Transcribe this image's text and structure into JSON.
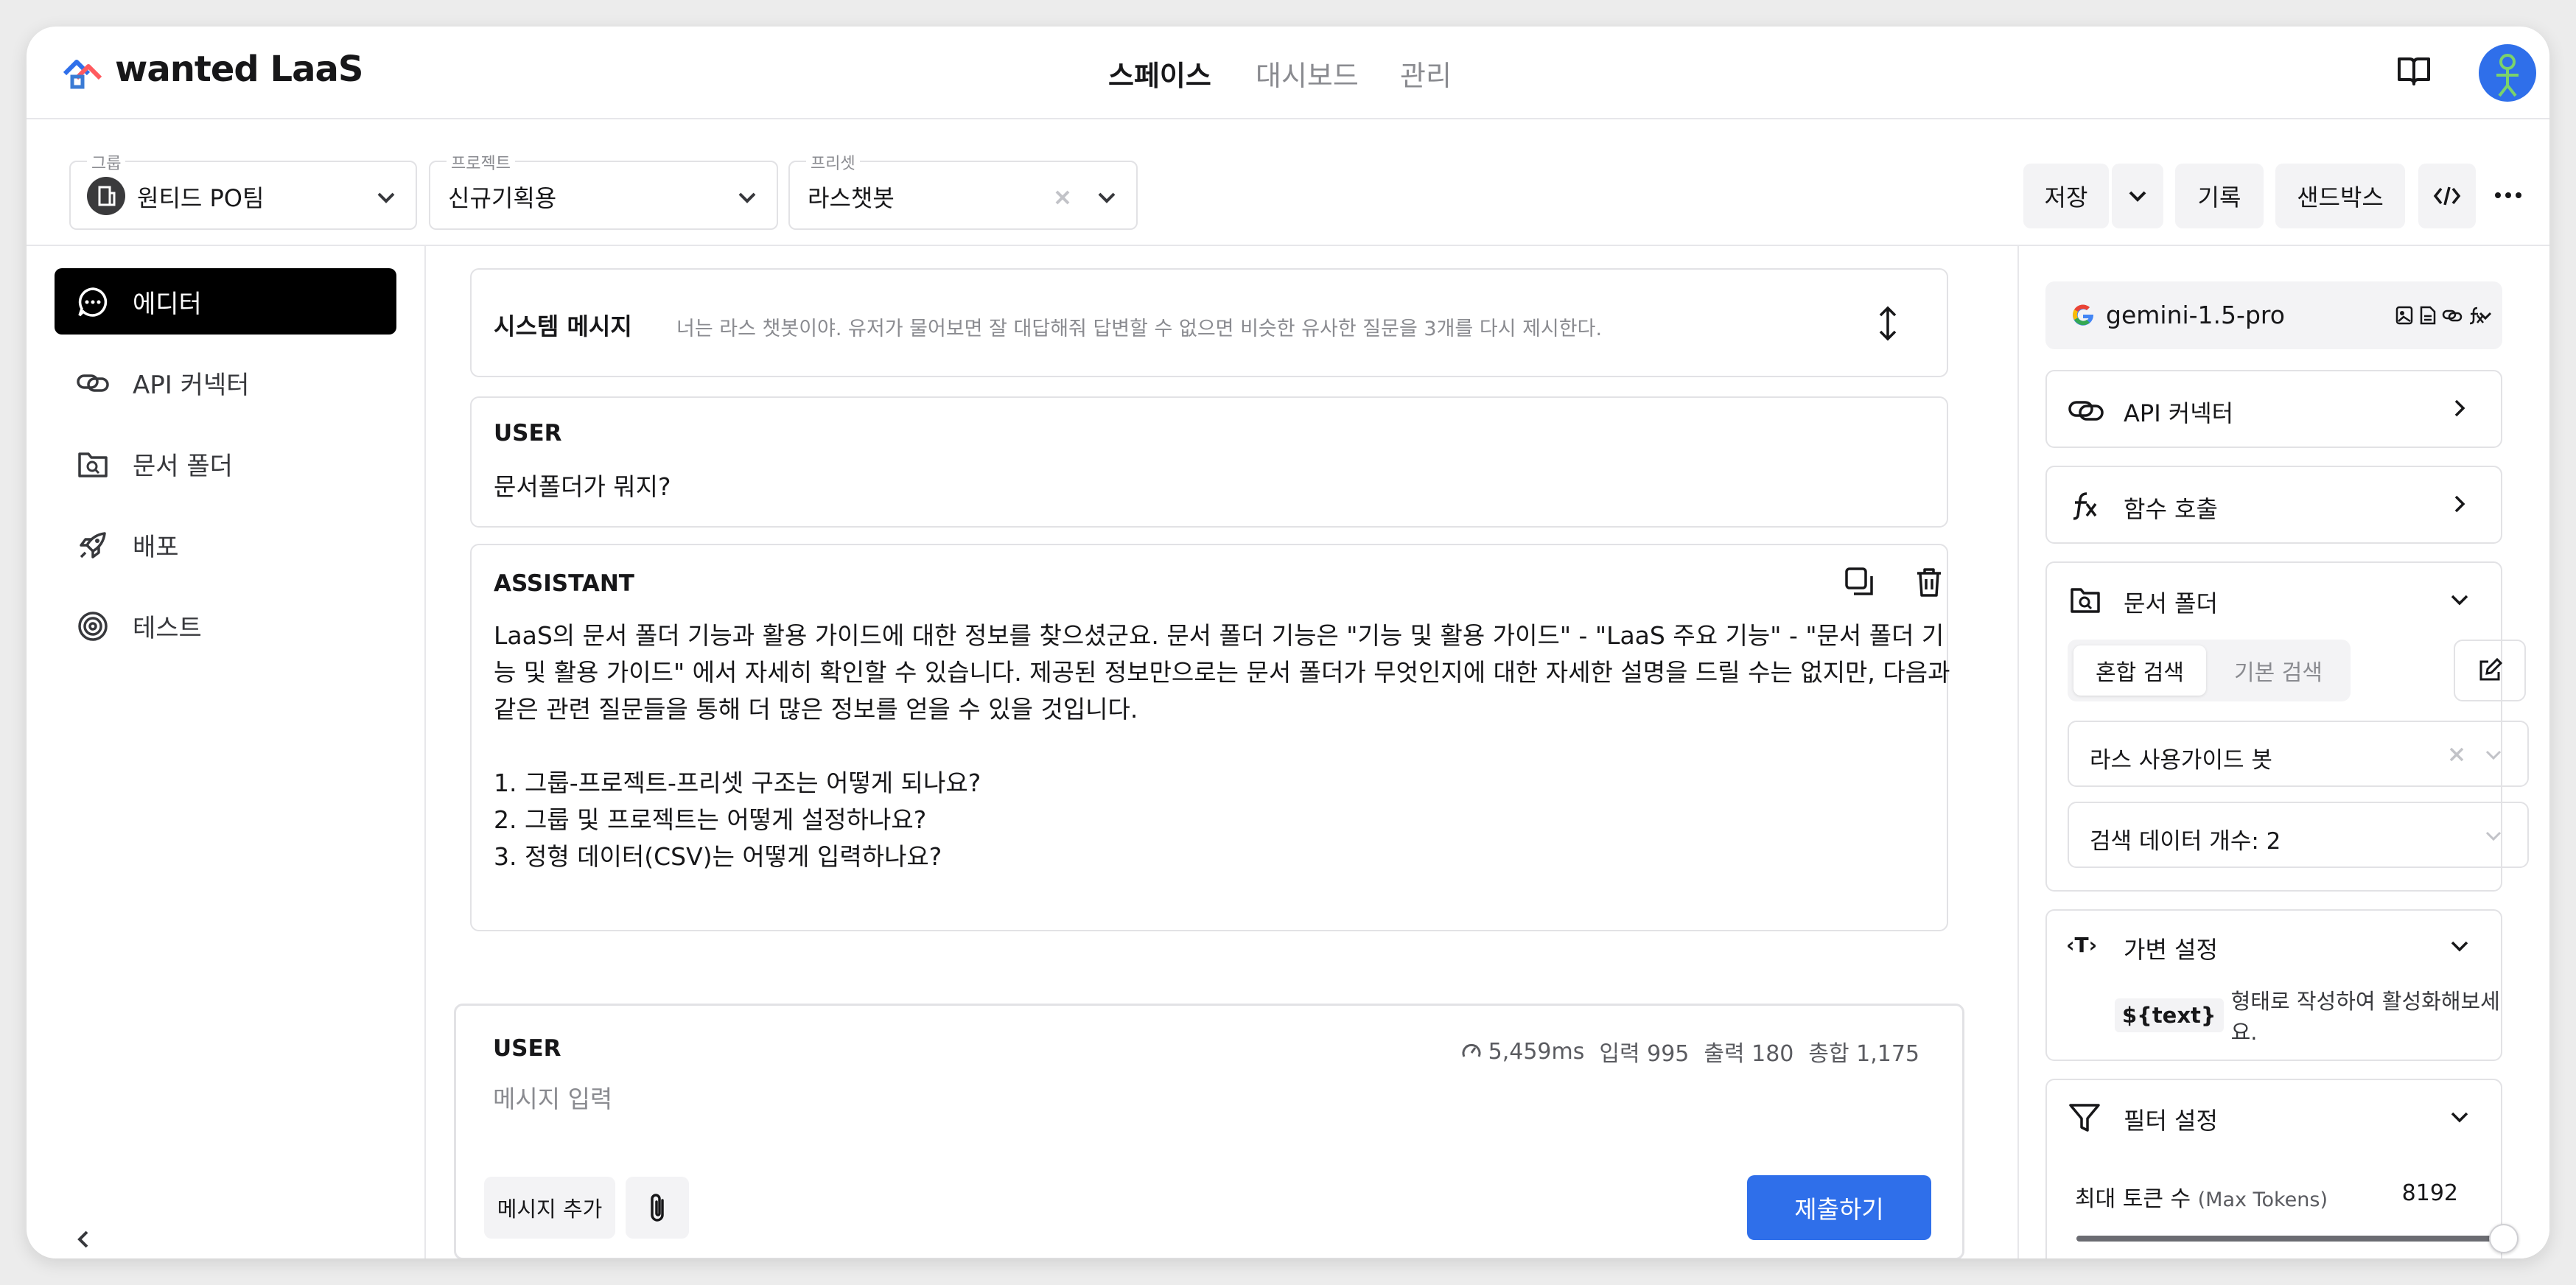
{
  "header": {
    "logo_text": "wanted LaaS",
    "nav": [
      {
        "label": "스페이스",
        "active": true
      },
      {
        "label": "대시보드",
        "active": false
      },
      {
        "label": "관리",
        "active": false
      }
    ]
  },
  "toolbar": {
    "group": {
      "label": "그룹",
      "value": "원티드 PO팀"
    },
    "project": {
      "label": "프로젝트",
      "value": "신규기획용"
    },
    "preset": {
      "label": "프리셋",
      "value": "라스챗봇"
    },
    "save_label": "저장",
    "history_label": "기록",
    "sandbox_label": "샌드박스"
  },
  "sidebar": {
    "items": [
      {
        "label": "에디터",
        "icon": "chat-bubble-icon",
        "active": true
      },
      {
        "label": "API 커넥터",
        "icon": "link-icon",
        "active": false
      },
      {
        "label": "문서 폴더",
        "icon": "folder-search-icon",
        "active": false
      },
      {
        "label": "배포",
        "icon": "rocket-icon",
        "active": false
      },
      {
        "label": "테스트",
        "icon": "target-icon",
        "active": false
      }
    ]
  },
  "editor": {
    "system_label": "시스템 메시지",
    "system_text": "너는 라스 챗봇이야. 유저가 물어보면 잘 대답해줘 답변할 수 없으면 비슷한 유사한 질문을 3개를 다시 제시한다.",
    "user_role": "USER",
    "user_text": "문서폴더가 뭐지?",
    "assistant_role": "ASSISTANT",
    "assistant_lines": [
      "LaaS의 문서 폴더 기능과 활용 가이드에 대한 정보를 찾으셨군요. 문서 폴더 기능은 \"기능 및 활용 가이드\" - \"LaaS 주요 기능\" - \"문서 폴더 기",
      "능 및 활용 가이드\" 에서 자세히 확인할 수 있습니다.  제공된 정보만으로는 문서 폴더가 무엇인지에 대한 자세한 설명을 드릴 수는 없지만, 다음과",
      "같은 관련 질문들을 통해 더 많은 정보를 얻을 수 있을 것입니다.",
      "",
      "1. 그룹-프로젝트-프리셋 구조는 어떻게 되나요?",
      "2. 그룹 및 프로젝트는 어떻게 설정하나요?",
      "3. 정형 데이터(CSV)는 어떻게 입력하나요?"
    ]
  },
  "composer": {
    "role": "USER",
    "latency": "5,459ms",
    "input_tokens": "입력 995",
    "output_tokens": "출력 180",
    "total_tokens": "총합 1,175",
    "placeholder": "메시지 입력",
    "add_message_label": "메시지 추가",
    "submit_label": "제출하기"
  },
  "right_panel": {
    "model": "gemini-1.5-pro",
    "api_connector_label": "API 커넥터",
    "function_call_label": "함수 호출",
    "doc_folder": {
      "title": "문서 폴더",
      "tabs": [
        "혼합 검색",
        "기본 검색"
      ],
      "active_tab": 0,
      "selected_folder": "라스 사용가이드 봇",
      "search_count": "검색 데이터 개수: 2"
    },
    "variable": {
      "title": "가변 설정",
      "token": "${text}",
      "hint": "형태로 작성하여 활성화해보세요."
    },
    "filter": {
      "title": "필터 설정",
      "max_tokens_label": "최대 토큰 수",
      "max_tokens_sub": "(Max Tokens)",
      "max_tokens_value": "8192",
      "max_tokens_fraction": 1.0
    }
  },
  "colors": {
    "primary": "#2f6fea",
    "text": "#171719",
    "muted": "#8a8b90",
    "border": "#e2e2e5"
  }
}
